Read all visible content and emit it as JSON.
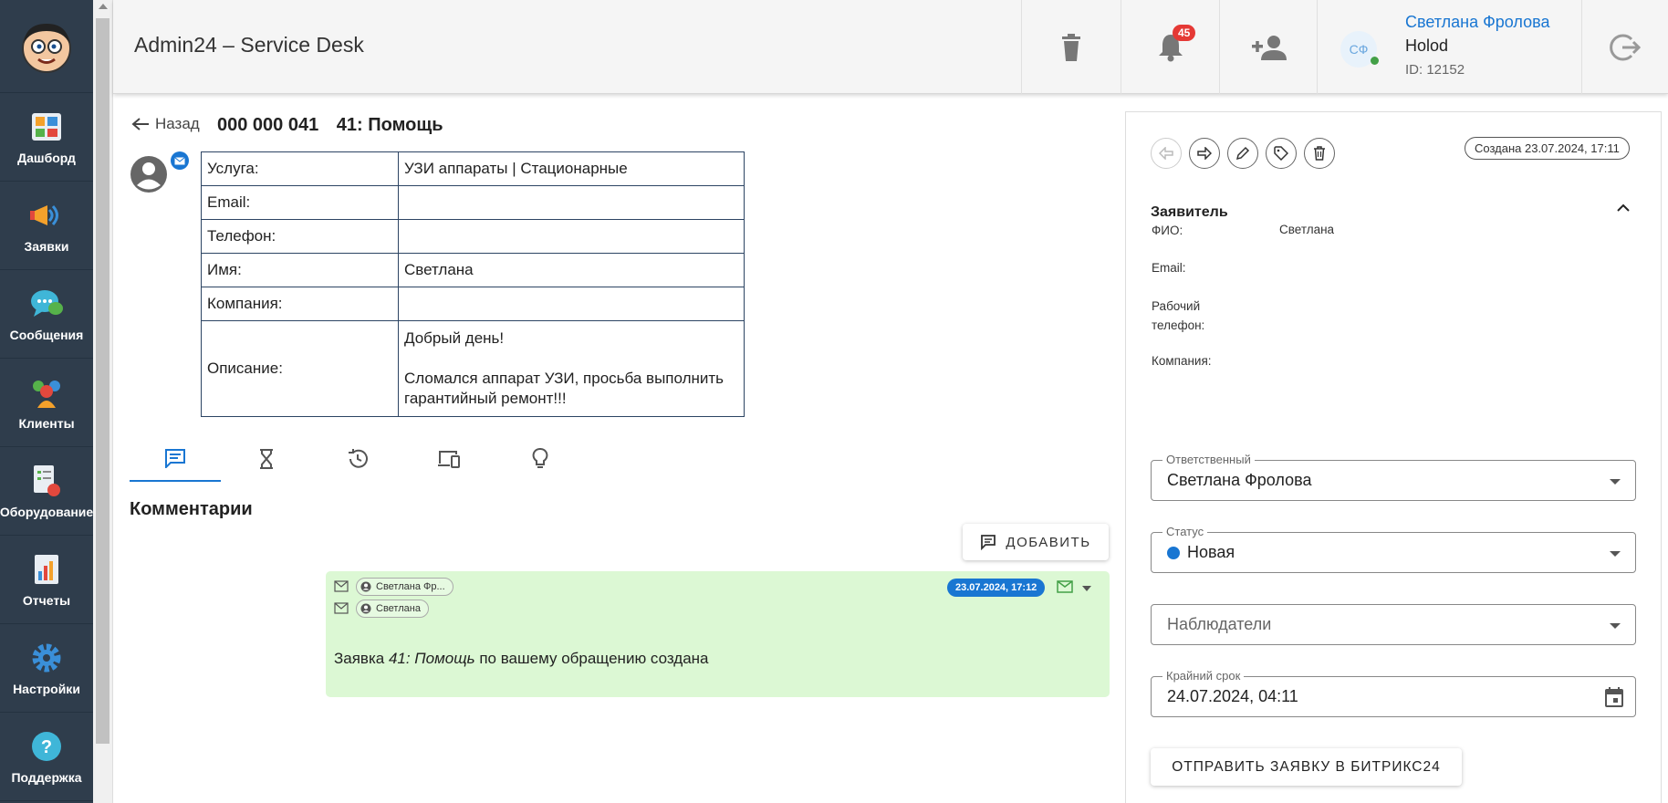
{
  "header": {
    "title": "Admin24 – Service Desk",
    "notifications_count": "45",
    "user": {
      "initials": "СФ",
      "name": "Светлана Фролова",
      "company": "Holod",
      "id_text": "ID: 12152"
    }
  },
  "sidebar": {
    "items": [
      {
        "label": "Дашборд",
        "icon": "dashboard-icon"
      },
      {
        "label": "Заявки",
        "icon": "megaphone-icon"
      },
      {
        "label": "Сообщения",
        "icon": "chat-icon"
      },
      {
        "label": "Клиенты",
        "icon": "clients-icon"
      },
      {
        "label": "Оборудование",
        "icon": "equipment-icon"
      },
      {
        "label": "Отчеты",
        "icon": "reports-icon"
      },
      {
        "label": "Настройки",
        "icon": "gear-icon"
      },
      {
        "label": "Поддержка",
        "icon": "support-icon"
      }
    ]
  },
  "ticket": {
    "back_label": "Назад",
    "number": "000 000 041",
    "name": "41: Помощь",
    "info": [
      {
        "k": "Услуга:",
        "v": "УЗИ аппараты | Стационарные"
      },
      {
        "k": "Email:",
        "v": ""
      },
      {
        "k": "Телефон:",
        "v": ""
      },
      {
        "k": "Имя:",
        "v": "Светлана"
      },
      {
        "k": "Компания:",
        "v": ""
      }
    ],
    "description_label": "Описание:",
    "description_line1": "Добрый день!",
    "description_line2": "Сломался аппарат УЗИ, просьба выполнить гарантийный ремонт!!!"
  },
  "comments": {
    "title": "Комментарии",
    "add_label": "ДОБАВИТЬ",
    "items": [
      {
        "from": "Светлана Фр...",
        "to": "Светлана",
        "date": "23.07.2024, 17:12",
        "text_prefix": "Заявка ",
        "text_ticket": "41: Помощь",
        "text_suffix": " по вашему обращению создана"
      }
    ]
  },
  "panel": {
    "created": "Создана 23.07.2024, 17:11",
    "requester_title": "Заявитель",
    "fields": {
      "fio_label": "ФИО:",
      "fio_value": "Светлана",
      "email_label": "Email:",
      "phone_label_1": "Рабочий",
      "phone_label_2": "телефон:",
      "company_label": "Компания:"
    },
    "responsible_label": "Ответственный",
    "responsible_value": "Светлана Фролова",
    "status_label": "Статус",
    "status_value": "Новая",
    "status_color": "#1976d2",
    "watchers_placeholder": "Наблюдатели",
    "deadline_label": "Крайний срок",
    "deadline_value": "24.07.2024, 04:11",
    "bitrix_button": "ОТПРАВИТЬ ЗАЯВКУ В БИТРИКС24"
  },
  "colors": {
    "sidebar": "#2f3d4c",
    "accent": "#1976d2",
    "comment_bg": "#dcf8d4",
    "badge": "#e53935"
  }
}
